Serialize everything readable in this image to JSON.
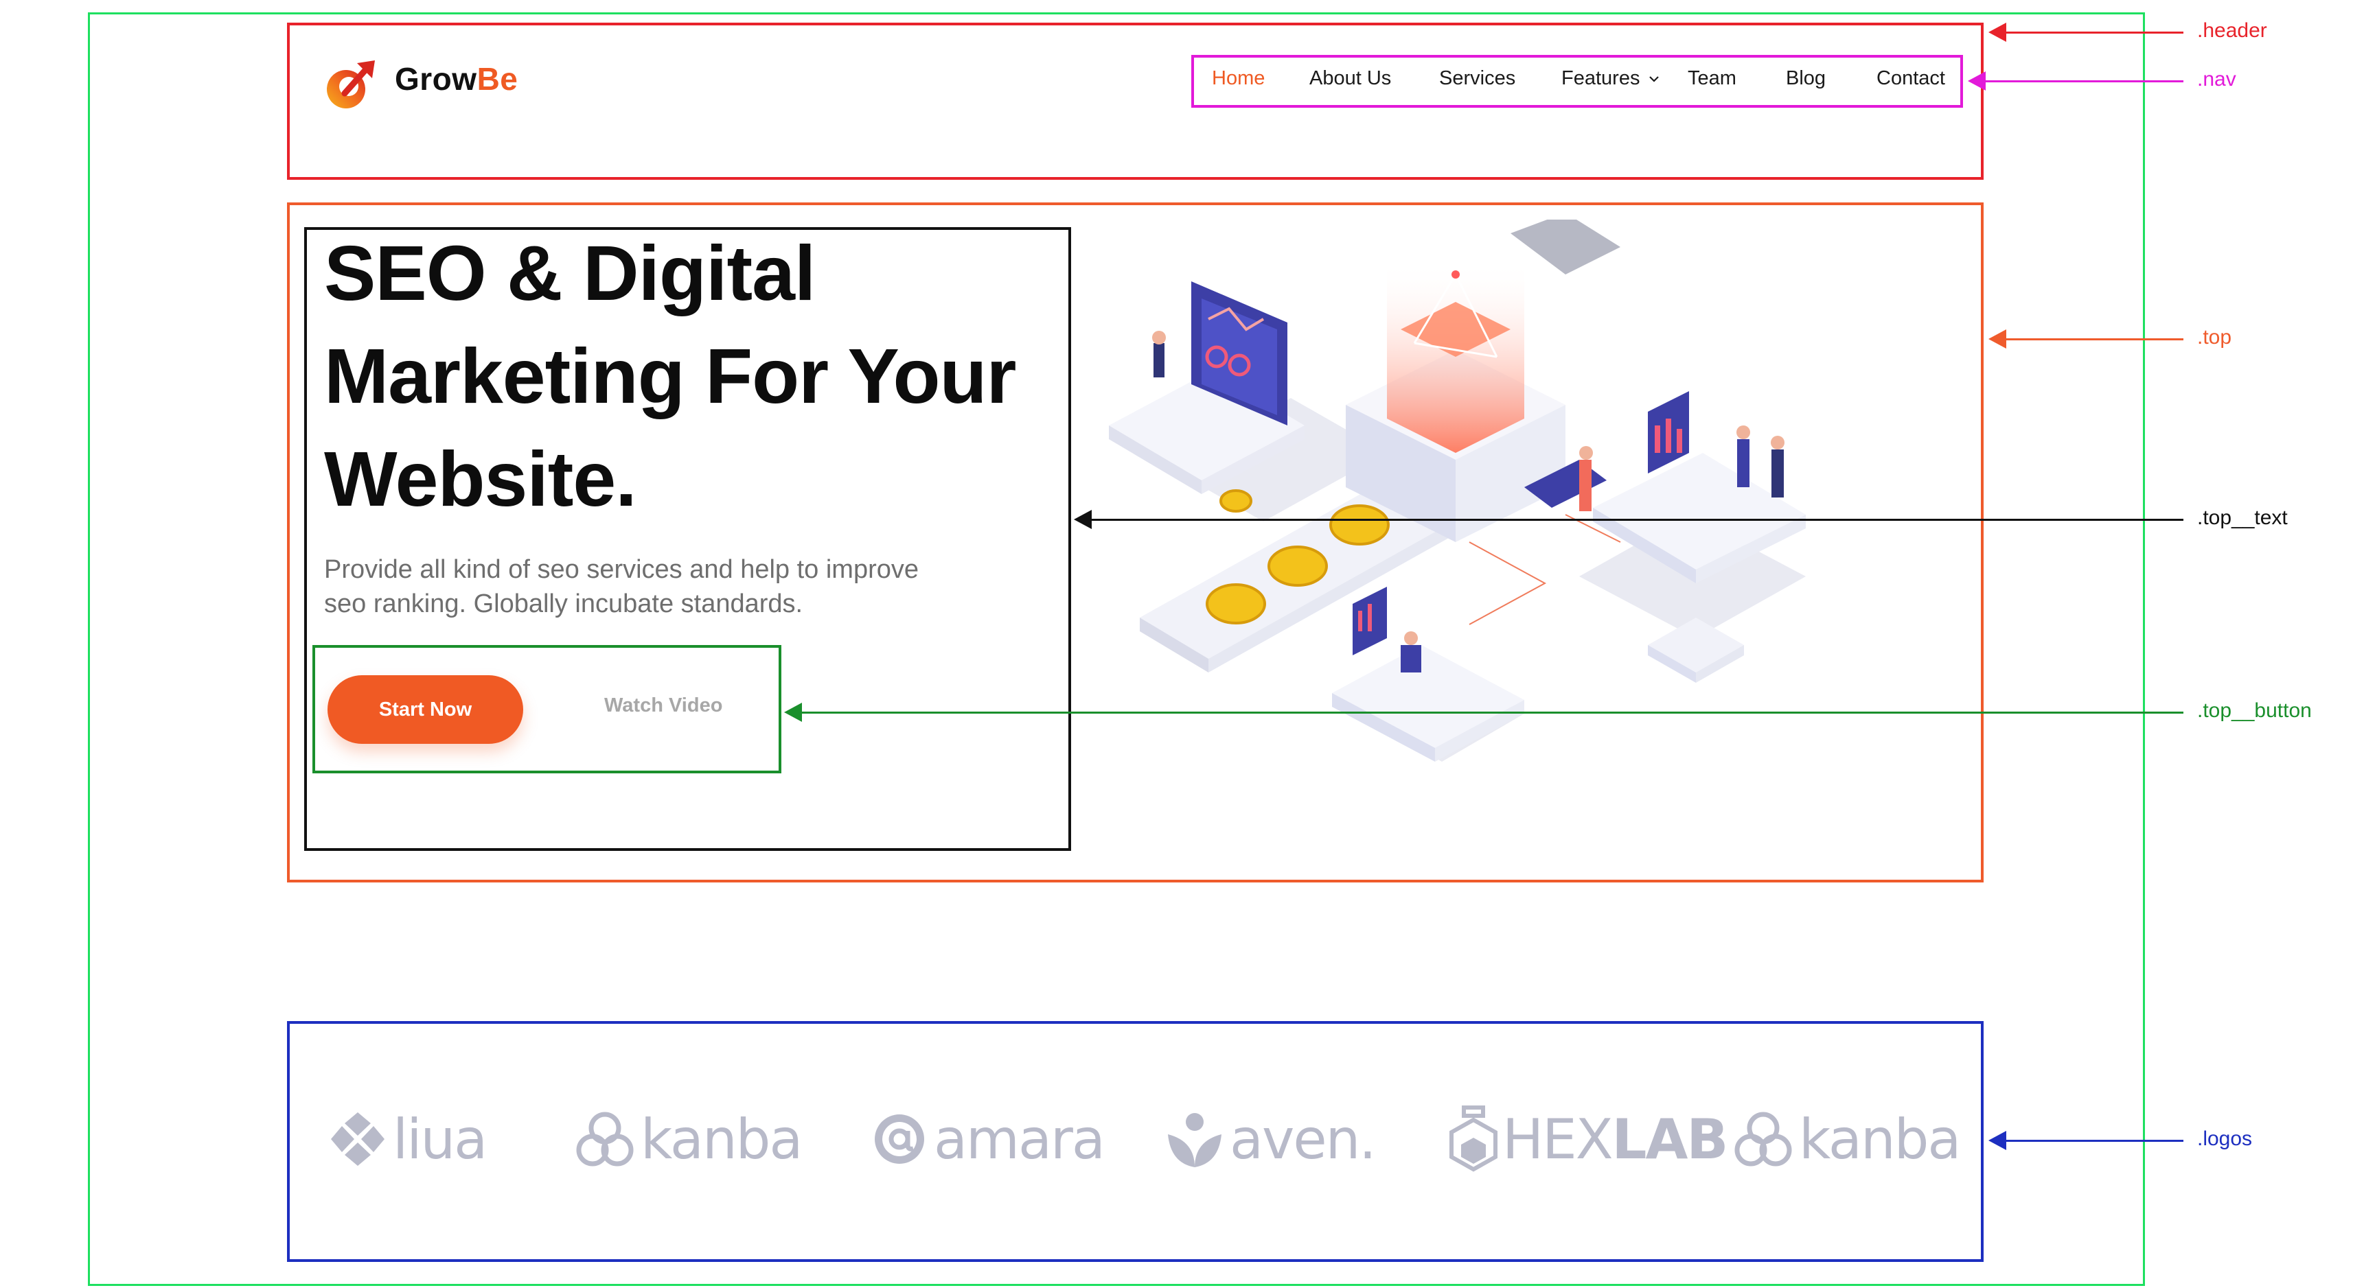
{
  "brand": {
    "name_part1": "Grow",
    "name_part2": "Be",
    "accent_color": "#ef5a23"
  },
  "nav": {
    "items": [
      {
        "label": "Home",
        "active": true
      },
      {
        "label": "About Us"
      },
      {
        "label": "Services"
      },
      {
        "label": "Features",
        "has_dropdown": true
      },
      {
        "label": "Team"
      },
      {
        "label": "Blog"
      },
      {
        "label": "Contact"
      }
    ]
  },
  "hero": {
    "title": "SEO & Digital\nMarketing For Your\nWebsite.",
    "description": "Provide all kind of seo services and help to improve\nseo ranking. Globally incubate standards.",
    "primary_button": "Start Now",
    "secondary_button": "Watch Video",
    "illustration_icon": "isometric-seo-illustration"
  },
  "logos": [
    {
      "name": "liua",
      "icon": "liua-logo-icon"
    },
    {
      "name": "kanba",
      "icon": "kanba-logo-icon"
    },
    {
      "name": "amara",
      "icon": "amara-logo-icon"
    },
    {
      "name": "aven.",
      "icon": "aven-logo-icon"
    },
    {
      "name_part1": "HEX",
      "name_part2": "LAB",
      "icon": "hexlab-logo-icon"
    },
    {
      "name": "kanba",
      "icon": "kanba-logo-icon"
    }
  ],
  "annotations": {
    "header": ".header",
    "nav": ".nav",
    "top": ".top",
    "top_text": ".top__text",
    "top_button": ".top__button",
    "logos": ".logos"
  },
  "colors": {
    "header_box": "#e8232b",
    "nav_box": "#e21ad9",
    "top_box": "#ef5b2c",
    "top_text_box": "#111111",
    "top_button_box": "#1a8f2c",
    "logos_box": "#1d2fc0",
    "outer_box": "#1ee060"
  }
}
